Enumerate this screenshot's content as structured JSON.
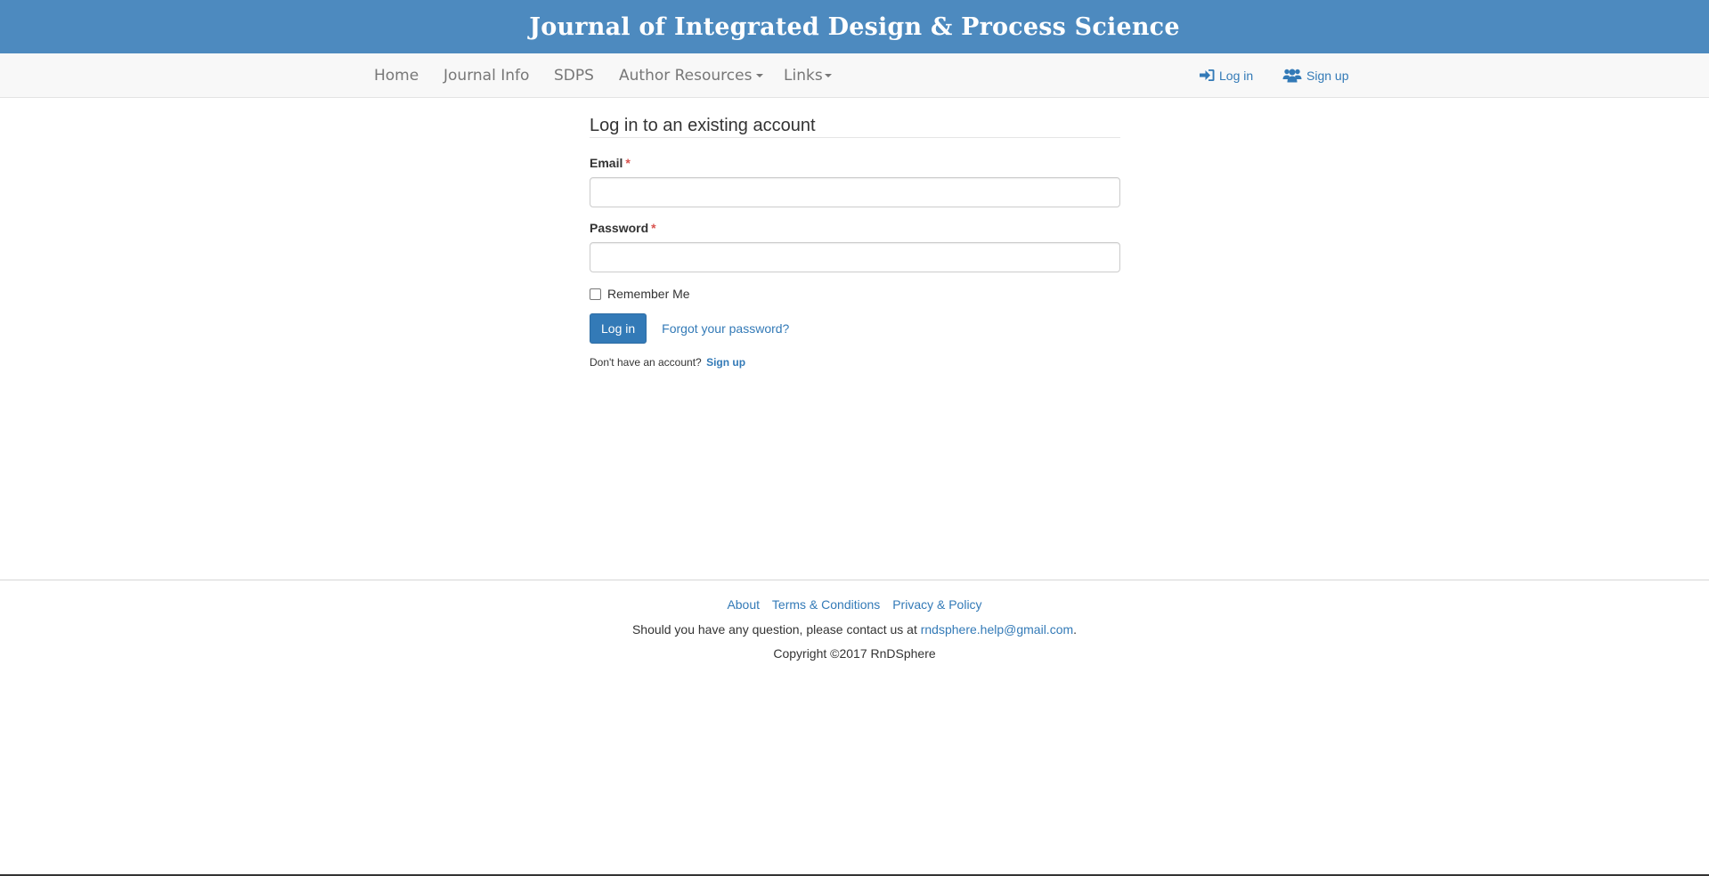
{
  "banner": {
    "title": "Journal of Integrated Design & Process Science"
  },
  "nav": {
    "items": [
      {
        "label": "Home",
        "dropdown": false
      },
      {
        "label": "Journal Info",
        "dropdown": false
      },
      {
        "label": "SDPS",
        "dropdown": false
      },
      {
        "label": "Author Resources",
        "dropdown": true
      },
      {
        "label": "Links",
        "dropdown": true
      }
    ],
    "login": {
      "label": "Log in",
      "icon": "sign-in-icon"
    },
    "signup": {
      "label": "Sign up",
      "icon": "users-icon"
    }
  },
  "login_form": {
    "heading": "Log in to an existing account",
    "email_label": "Email",
    "email_value": "",
    "password_label": "Password",
    "password_value": "",
    "required_marker": "*",
    "remember_label": "Remember Me",
    "remember_checked": false,
    "submit_label": "Log in",
    "forgot_label": "Forgot your password?",
    "no_account_text": "Don't have an account?",
    "signup_link": "Sign up"
  },
  "footer": {
    "links": [
      "About",
      "Terms & Conditions",
      "Privacy & Policy"
    ],
    "contact_text": "Should you have any question, please contact us at",
    "contact_email": "rndsphere.help@gmail.com",
    "contact_suffix": ".",
    "copyright": "Copyright ©2017 RnDSphere"
  },
  "colors": {
    "banner_bg": "#4d8abf",
    "link": "#337ab7",
    "primary_button": "#337ab7",
    "required": "#d9534f"
  }
}
